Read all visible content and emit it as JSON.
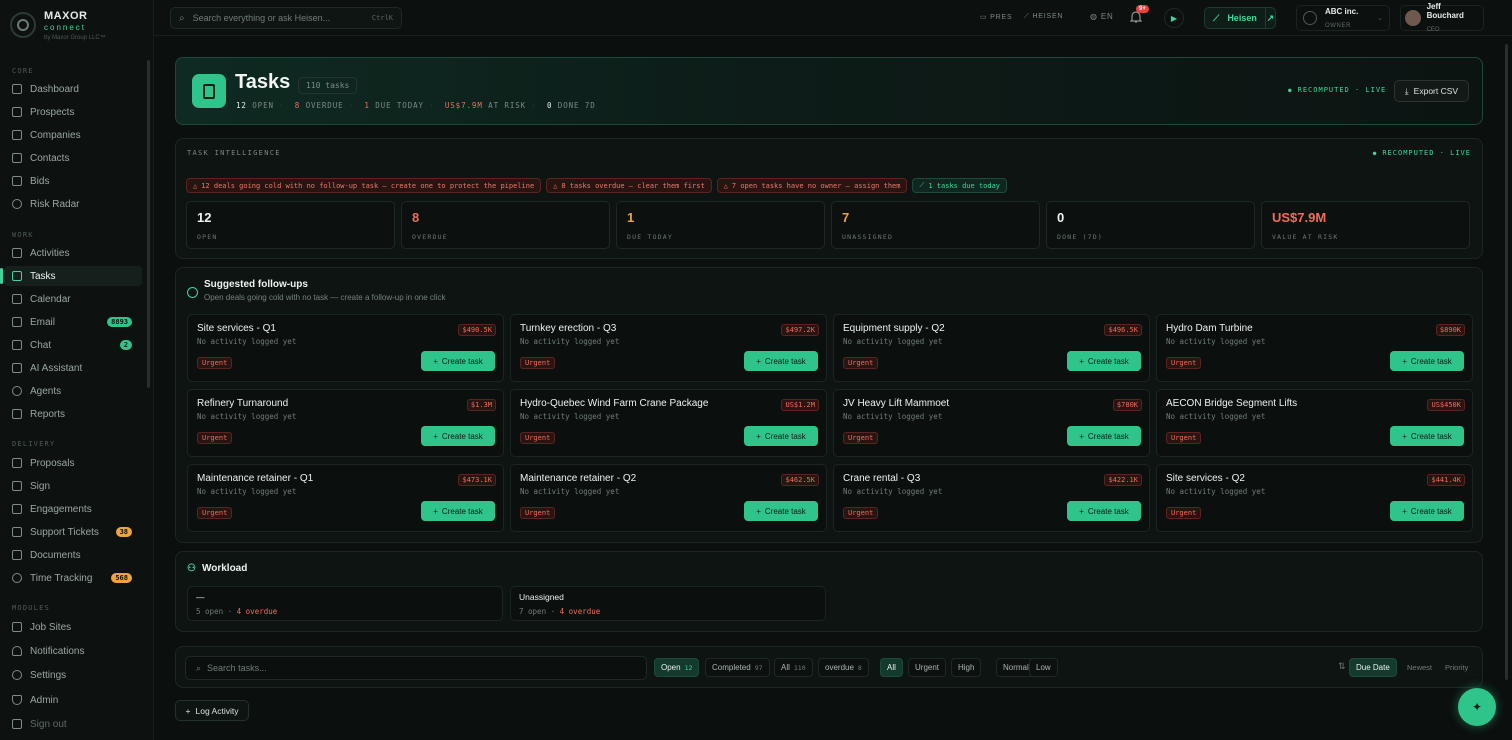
{
  "brand": {
    "name": "MAXOR",
    "sub": "connect",
    "by": "by Maxor Group LLC™"
  },
  "sidebar": {
    "sections": {
      "core": "CORE",
      "work": "WORK",
      "delivery": "DELIVERY",
      "modules": "MODULES"
    },
    "items": [
      {
        "label": "Dashboard"
      },
      {
        "label": "Prospects"
      },
      {
        "label": "Companies"
      },
      {
        "label": "Contacts"
      },
      {
        "label": "Bids"
      },
      {
        "label": "Risk Radar"
      },
      {
        "label": "Activities"
      },
      {
        "label": "Tasks"
      },
      {
        "label": "Calendar"
      },
      {
        "label": "Email",
        "badge": "8893"
      },
      {
        "label": "Chat",
        "badge": "2"
      },
      {
        "label": "AI Assistant"
      },
      {
        "label": "Agents"
      },
      {
        "label": "Reports"
      },
      {
        "label": "Proposals"
      },
      {
        "label": "Sign"
      },
      {
        "label": "Engagements"
      },
      {
        "label": "Support Tickets",
        "badge": "38"
      },
      {
        "label": "Documents"
      },
      {
        "label": "Time Tracking",
        "badge": "568"
      },
      {
        "label": "Job Sites"
      },
      {
        "label": "Notifications"
      },
      {
        "label": "Settings"
      },
      {
        "label": "Admin"
      },
      {
        "label": "Sign out"
      }
    ]
  },
  "topbar": {
    "search_placeholder": "Search everything or ask Heisen...",
    "search_kbd": "CtrlK",
    "pres": "PRES",
    "heisen_link": "HEISEN",
    "lang": "EN",
    "notif_badge": "9+",
    "heisen_button": "Heisen",
    "company": {
      "name": "ABC inc.",
      "role": "OWNER"
    },
    "user": {
      "name": "Jeff Bouchard",
      "role": "CEO"
    }
  },
  "hero": {
    "title": "Tasks",
    "count": "110 tasks",
    "stats": {
      "open_n": "12",
      "open_l": "OPEN",
      "overdue_n": "8",
      "overdue_l": "OVERDUE",
      "due_n": "1",
      "due_l": "DUE TODAY",
      "risk_n": "US$7.9M",
      "risk_l": "AT RISK",
      "done_n": "0",
      "done_l": "DONE 7D"
    },
    "live": "RECOMPUTED · LIVE",
    "export": "Export CSV"
  },
  "intel": {
    "title": "TASK INTELLIGENCE",
    "live": "RECOMPUTED · LIVE",
    "chips": [
      {
        "text": "12 deals going cold with no follow-up task — create one to protect the pipeline",
        "tone": "red"
      },
      {
        "text": "8 tasks overdue — clear them first",
        "tone": "red"
      },
      {
        "text": "7 open tasks have no owner — assign them",
        "tone": "red"
      },
      {
        "text": "1 tasks due today",
        "tone": "green"
      }
    ],
    "stats": [
      {
        "value": "12",
        "label": "OPEN",
        "color": "#eef3f0"
      },
      {
        "value": "8",
        "label": "OVERDUE",
        "color": "#ef6d5a"
      },
      {
        "value": "1",
        "label": "DUE TODAY",
        "color": "#f0a23c"
      },
      {
        "value": "7",
        "label": "UNASSIGNED",
        "color": "#f0a23c"
      },
      {
        "value": "0",
        "label": "DONE (7D)",
        "color": "#eef3f0"
      },
      {
        "value": "US$7.9M",
        "label": "VALUE AT RISK",
        "color": "#ef6d5a"
      }
    ]
  },
  "suggestions": {
    "title": "Suggested follow-ups",
    "subtitle": "Open deals going cold with no task — create a follow-up in one click",
    "meta": "No activity logged yet",
    "urgent": "Urgent",
    "create": "Create task",
    "cards": [
      {
        "name": "Site services - Q1",
        "amount": "$490.5K"
      },
      {
        "name": "Turnkey erection - Q3",
        "amount": "$497.2K"
      },
      {
        "name": "Equipment supply - Q2",
        "amount": "$496.5K"
      },
      {
        "name": "Hydro Dam Turbine",
        "amount": "$890K"
      },
      {
        "name": "Refinery Turnaround",
        "amount": "$1.3M"
      },
      {
        "name": "Hydro-Quebec Wind Farm Crane Package",
        "amount": "US$1.2M"
      },
      {
        "name": "JV Heavy Lift Mammoet",
        "amount": "$780K"
      },
      {
        "name": "AECON Bridge Segment Lifts",
        "amount": "US$450K"
      },
      {
        "name": "Maintenance retainer - Q1",
        "amount": "$473.1K"
      },
      {
        "name": "Maintenance retainer - Q2",
        "amount": "$462.5K"
      },
      {
        "name": "Crane rental - Q3",
        "amount": "$422.1K"
      },
      {
        "name": "Site services - Q2",
        "amount": "$441.4K"
      }
    ]
  },
  "workload": {
    "title": "Workload",
    "cards": [
      {
        "name": "—",
        "open": "5 open",
        "overdue": "4 overdue"
      },
      {
        "name": "Unassigned",
        "open": "7 open",
        "overdue": "4 overdue"
      }
    ]
  },
  "filters": {
    "search_placeholder": "Search tasks...",
    "status": [
      {
        "label": "Open",
        "count": "12"
      },
      {
        "label": "Completed",
        "count": "97"
      },
      {
        "label": "All",
        "count": "110"
      },
      {
        "label": "overdue",
        "count": "8"
      }
    ],
    "priority": [
      "All",
      "Urgent",
      "High",
      "Normal",
      "Low"
    ],
    "sort": [
      "Due Date",
      "Newest",
      "Priority"
    ]
  },
  "log_activity": "Log Activity"
}
